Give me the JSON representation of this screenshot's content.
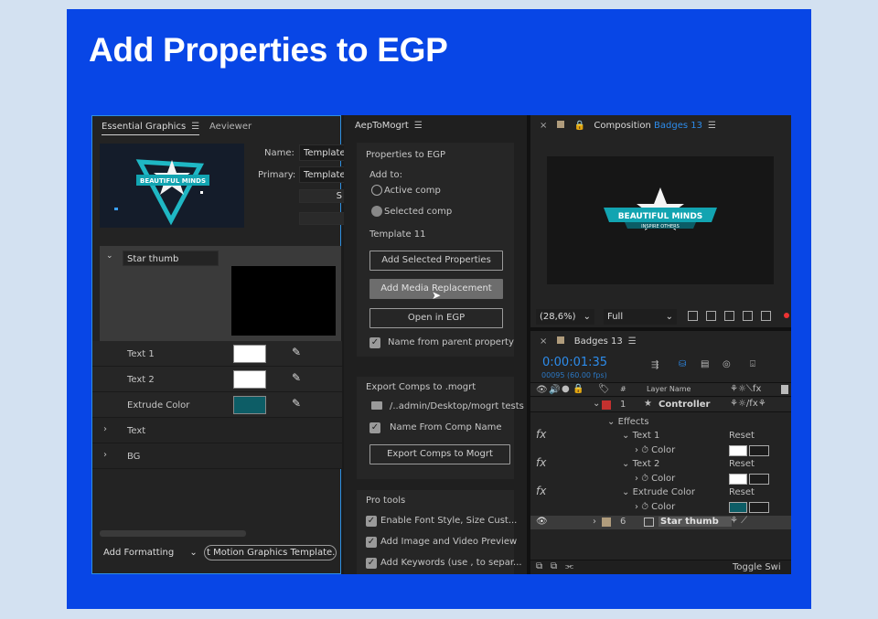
{
  "slide": {
    "title": "Add Properties to EGP"
  },
  "eg": {
    "tab_active": "Essential Graphics",
    "tab_other": "Aeviewer",
    "name_label": "Name:",
    "name_value": "Template",
    "primary_label": "Primary:",
    "primary_value": "Template",
    "cut_letter": "S",
    "group_name": "Star thumb",
    "props": [
      {
        "label": "Text 1",
        "color": "#ffffff"
      },
      {
        "label": "Text 2",
        "color": "#ffffff"
      },
      {
        "label": "Extrude Color",
        "color": "#0d5d66"
      }
    ],
    "groups": [
      "Text",
      "BG"
    ],
    "add_formatting": "Add Formatting",
    "export_label": "t Motion Graphics Template..."
  },
  "aep": {
    "tab": "AepToMogrt",
    "section1": "Properties to EGP",
    "add_to": "Add to:",
    "radio_active": "Active comp",
    "radio_selected": "Selected comp",
    "template_name": "Template 11",
    "btn_add_selected": "Add Selected Properties",
    "btn_add_media": "Add Media Replacement",
    "btn_open_egp": "Open in EGP",
    "chk_name_parent": "Name from parent property",
    "section2": "Export Comps to .mogrt",
    "path": "/..admin/Desktop/mogrt tests",
    "chk_name_comp": "Name From Comp Name",
    "btn_export": "Export Comps to Mogrt",
    "section3": "Pro tools",
    "pro": [
      "Enable Font Style, Size Cust...",
      "Add Image and Video Preview",
      "Add Keywords (use , to separ..."
    ]
  },
  "comp": {
    "tab_prefix": "Composition",
    "tab_name": "Badges 13",
    "badge_main": "BEAUTIFUL MINDS",
    "badge_sub": "INSPIRE OTHERS",
    "zoom": "(28,6%)",
    "resolution": "Full"
  },
  "timeline": {
    "tab": "Badges 13",
    "timecode": "0:00:01:35",
    "frames": "00095 (60.00 fps)",
    "col_num": "#",
    "col_layer": "Layer Name",
    "layer1_num": "1",
    "layer1_name": "Controller",
    "effects": "Effects",
    "fx": "fx",
    "reset": "Reset",
    "color": "Color",
    "effect_items": [
      {
        "name": "Text 1",
        "color": "#ffffff"
      },
      {
        "name": "Text 2",
        "color": "#ffffff"
      },
      {
        "name": "Extrude Color",
        "color": "#0d5d66"
      }
    ],
    "layer6_num": "6",
    "layer6_name": "Star thumb",
    "toggle": "Toggle Swi"
  },
  "colors": {
    "slide_bg": "#0846e6",
    "ae_blue": "#2d8ceb",
    "label_red": "#c4312f",
    "label_tan": "#b09c7c"
  }
}
